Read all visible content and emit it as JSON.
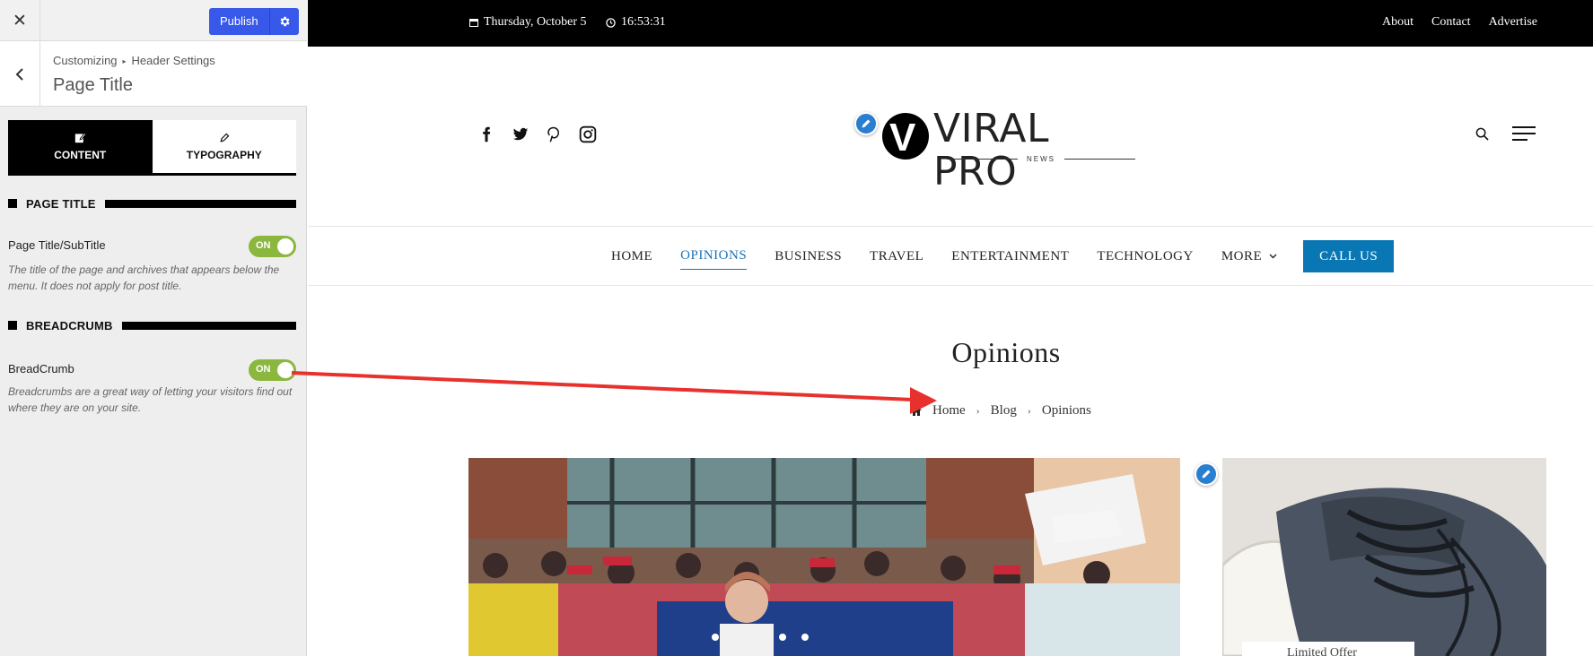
{
  "customizer": {
    "close_icon": "close-icon",
    "publish_label": "Publish",
    "breadcrumb": {
      "root": "Customizing",
      "parent": "Header Settings"
    },
    "title": "Page Title",
    "tabs": [
      {
        "label": "CONTENT",
        "icon": "edit-icon",
        "active": true
      },
      {
        "label": "TYPOGRAPHY",
        "icon": "pencil-icon",
        "active": false
      }
    ],
    "sections": {
      "page_title": {
        "heading": "PAGE TITLE",
        "option_label": "Page Title/SubTitle",
        "toggle": "ON",
        "description": "The title of the page and archives that appears below the menu. It does not apply for post title."
      },
      "breadcrumb": {
        "heading": "BREADCRUMB",
        "option_label": "BreadCrumb",
        "toggle": "ON",
        "description": "Breadcrumbs are a great way of letting your visitors find out where they are on your site."
      }
    },
    "accent": "#3858e9",
    "toggle_color": "#8bb73f"
  },
  "site": {
    "topbar": {
      "date": "Thursday, October 5",
      "time": "16:53:31",
      "links": [
        "About",
        "Contact",
        "Advertise"
      ]
    },
    "social": [
      "facebook-icon",
      "twitter-icon",
      "pinterest-icon",
      "instagram-icon"
    ],
    "logo": {
      "title": "VIRAL PRO",
      "subtitle": "NEWS",
      "mark": "V"
    },
    "nav": {
      "items": [
        "HOME",
        "OPINIONS",
        "BUSINESS",
        "TRAVEL",
        "ENTERTAINMENT",
        "TECHNOLOGY"
      ],
      "active": "OPINIONS",
      "more": "MORE",
      "cta": "CALL US"
    },
    "page": {
      "title": "Opinions",
      "breadcrumb": [
        "Home",
        "Blog",
        "Opinions"
      ]
    },
    "side_card_label": "Limited Offer",
    "accent": "#0a77b5"
  }
}
